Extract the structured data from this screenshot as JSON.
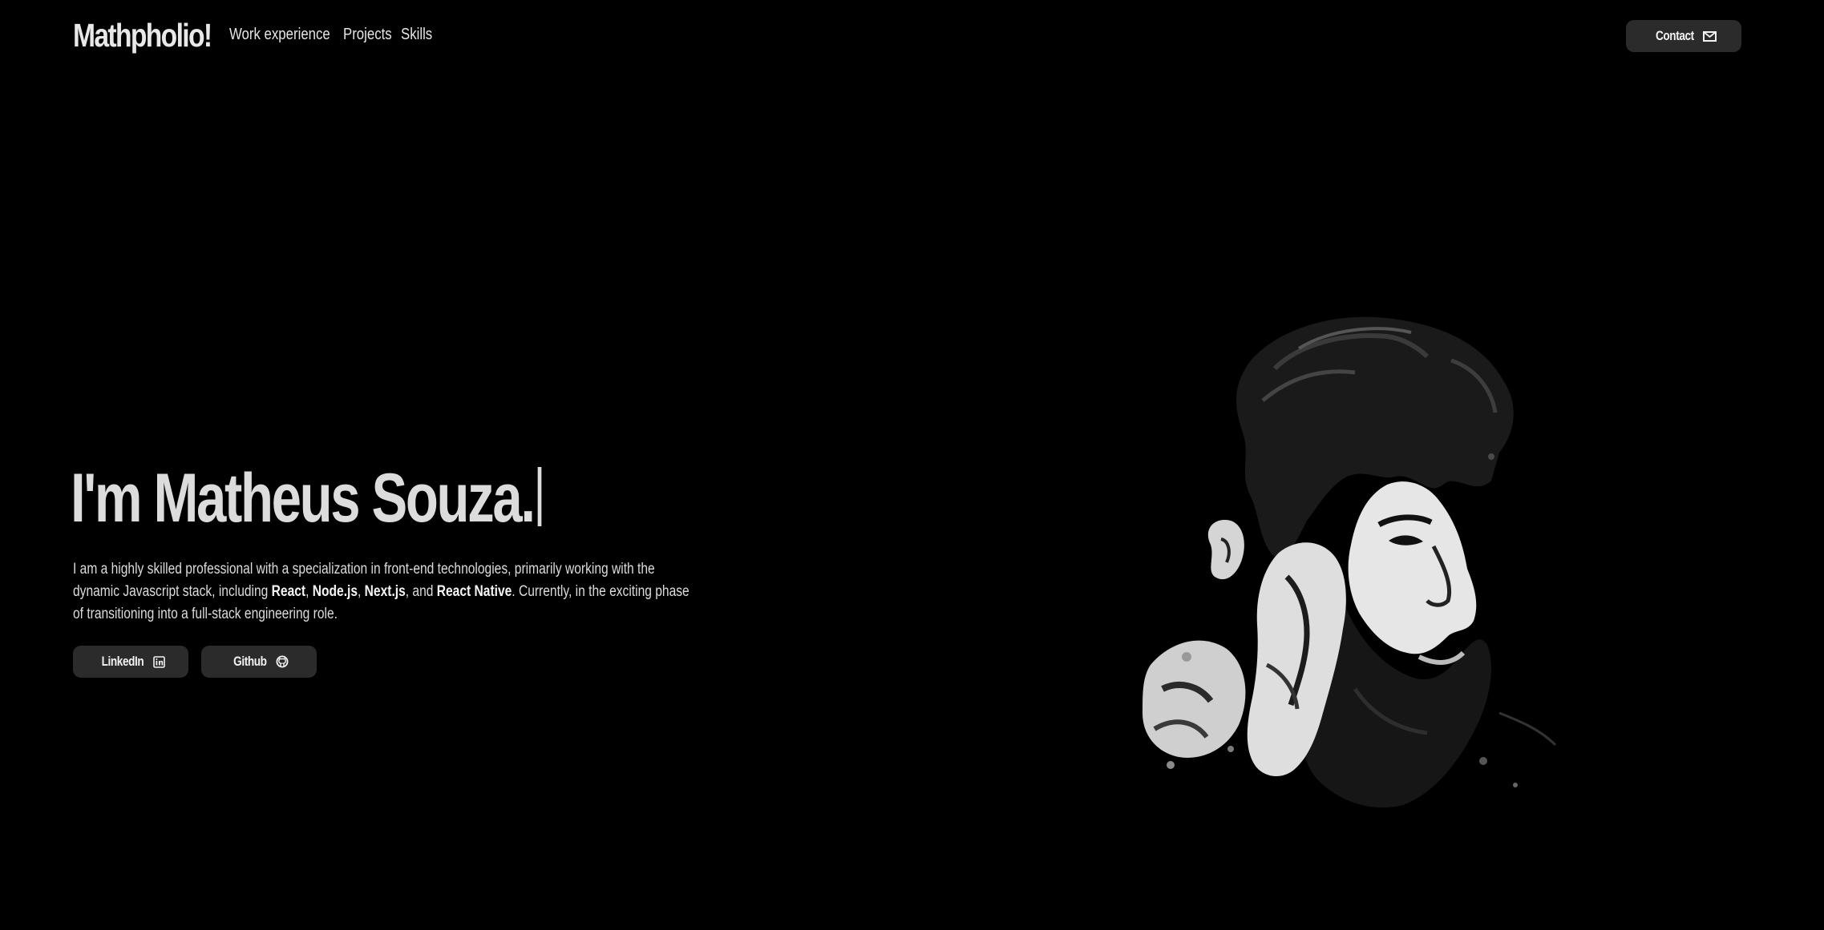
{
  "header": {
    "brand": "Mathpholio!",
    "nav": [
      {
        "label": "Work experience"
      },
      {
        "label": "Projects"
      },
      {
        "label": "Skills"
      }
    ],
    "contact": {
      "label": "Contact",
      "icon": "mail-icon"
    }
  },
  "hero": {
    "title": "I'm Matheus Souza.",
    "description": {
      "p1": "I am a highly skilled professional with a specialization in front-end technologies, primarily working with the dynamic Javascript stack, including ",
      "tech1": "React",
      "sep1": ", ",
      "tech2": "Node.js",
      "sep2": ", ",
      "tech3": "Next.js",
      "sep3": ", and ",
      "tech4": "React Native",
      "p2": ". Currently, in the exciting phase of transitioning into a full-stack engineering role."
    },
    "buttons": [
      {
        "label": "LinkedIn",
        "icon": "linkedin-icon"
      },
      {
        "label": "Github",
        "icon": "github-icon"
      }
    ],
    "portrait_icon": "portrait-image"
  },
  "colors": {
    "background": "#000000",
    "text": "#e6e6e6",
    "button_bg": "#2b2b2b"
  }
}
